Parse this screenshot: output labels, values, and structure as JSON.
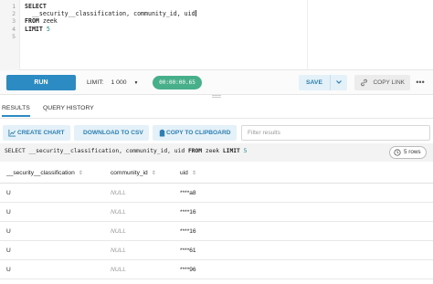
{
  "editor": {
    "line_numbers": [
      "1",
      "2",
      "3",
      "4",
      "5"
    ],
    "lines": [
      {
        "kw": "SELECT",
        "rest": ""
      },
      {
        "kw": "",
        "rest": "  __security__classification, community_id, uid"
      },
      {
        "kw": "FROM",
        "rest": " zeek"
      },
      {
        "kw": "LIMIT",
        "rest": " ",
        "num": "5"
      }
    ]
  },
  "toolbar": {
    "run_label": "RUN",
    "limit_label": "LIMIT:",
    "limit_value": "1 000",
    "timer": "00:00:00.65",
    "save_label": "SAVE",
    "copy_link_label": "COPY LINK",
    "more_label": "•••"
  },
  "tabs": [
    {
      "label": "RESULTS",
      "active": true
    },
    {
      "label": "QUERY HISTORY",
      "active": false
    }
  ],
  "result_tools": {
    "create_chart": "CREATE CHART",
    "download_csv": "DOWNLOAD TO CSV",
    "copy_clipboard": "COPY TO CLIPBOARD",
    "filter_placeholder": "Filter results"
  },
  "query_bar": {
    "pre": "SELECT __security__classification, community_id, uid ",
    "from_kw": "FROM",
    "mid": " zeek ",
    "limit_kw": "LIMIT",
    "limit_num": " 5",
    "rows": "5 rows"
  },
  "table": {
    "columns": [
      "__security__classification",
      "community_id",
      "uid"
    ],
    "rows": [
      [
        "U",
        "NULL",
        "****a8"
      ],
      [
        "U",
        "NULL",
        "****16"
      ],
      [
        "U",
        "NULL",
        "****16"
      ],
      [
        "U",
        "NULL",
        "****61"
      ],
      [
        "U",
        "NULL",
        "****96"
      ]
    ]
  },
  "colors": {
    "accent": "#2d8bc4",
    "timer": "#47b08a",
    "button_bg": "#e4f1f8"
  }
}
